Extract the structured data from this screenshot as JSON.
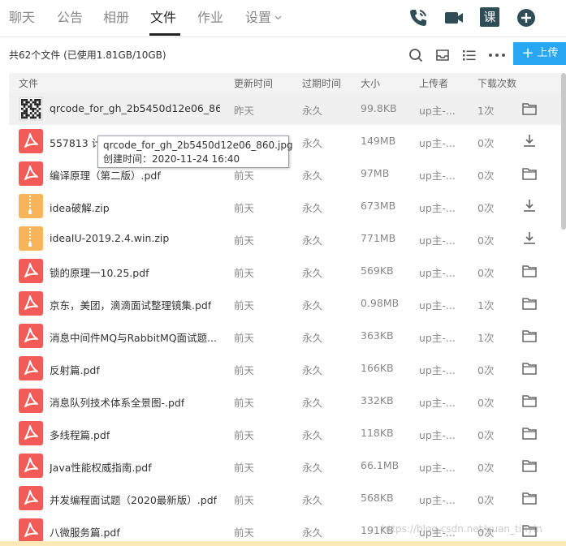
{
  "tabs": [
    {
      "label": "聊天",
      "active": false
    },
    {
      "label": "公告",
      "active": false
    },
    {
      "label": "相册",
      "active": false
    },
    {
      "label": "文件",
      "active": true
    },
    {
      "label": "作业",
      "active": false
    },
    {
      "label": "设置",
      "active": false
    }
  ],
  "top_icons": [
    "phone-icon",
    "video-icon",
    "course-icon",
    "add-icon"
  ],
  "course_icon_text": "课",
  "summary": "共62个文件 (已使用1.81GB/10GB)",
  "toolbar_icons": [
    "search-icon",
    "inbox-icon",
    "list-view-icon",
    "more-icon"
  ],
  "upload_label": "上传",
  "columns": {
    "name": "文件",
    "updated": "更新时间",
    "expires": "过期时间",
    "size": "大小",
    "uploader": "上传者",
    "downloads": "下载次数"
  },
  "files": [
    {
      "name": "qrcode_for_gh_2b5450d12e06_86...",
      "type": "qr",
      "updated": "昨天",
      "expires": "永久",
      "size": "99.8KB",
      "uploader": "up主-...",
      "downloads": "1次",
      "action": "folder"
    },
    {
      "name": "557813 计...",
      "type": "pdf",
      "updated": "",
      "expires": "永久",
      "size": "149MB",
      "uploader": "up主-...",
      "downloads": "0次",
      "action": "download"
    },
    {
      "name": "编译原理（第二版）.pdf",
      "type": "pdf",
      "updated": "前天",
      "expires": "永久",
      "size": "97MB",
      "uploader": "up主-...",
      "downloads": "0次",
      "action": "folder"
    },
    {
      "name": "idea破解.zip",
      "type": "zip",
      "updated": "前天",
      "expires": "永久",
      "size": "673MB",
      "uploader": "up主-...",
      "downloads": "0次",
      "action": "download"
    },
    {
      "name": "ideaIU-2019.2.4.win.zip",
      "type": "zip",
      "updated": "前天",
      "expires": "永久",
      "size": "771MB",
      "uploader": "up主-...",
      "downloads": "0次",
      "action": "download"
    },
    {
      "name": "锁的原理一10.25.pdf",
      "type": "pdf",
      "updated": "前天",
      "expires": "永久",
      "size": "569KB",
      "uploader": "up主-...",
      "downloads": "0次",
      "action": "folder"
    },
    {
      "name": "京东，美团，滴滴面试整理镜集.pdf",
      "type": "pdf",
      "updated": "前天",
      "expires": "永久",
      "size": "0.98MB",
      "uploader": "up主-...",
      "downloads": "1次",
      "action": "folder"
    },
    {
      "name": "消息中间件MQ与RabbitMQ面试题...",
      "type": "pdf",
      "updated": "前天",
      "expires": "永久",
      "size": "363KB",
      "uploader": "up主-...",
      "downloads": "1次",
      "action": "folder"
    },
    {
      "name": "反射篇.pdf",
      "type": "pdf",
      "updated": "前天",
      "expires": "永久",
      "size": "166KB",
      "uploader": "up主-...",
      "downloads": "0次",
      "action": "folder"
    },
    {
      "name": "消息队列技术体系全景图-.pdf",
      "type": "pdf",
      "updated": "前天",
      "expires": "永久",
      "size": "332KB",
      "uploader": "up主-...",
      "downloads": "0次",
      "action": "folder"
    },
    {
      "name": "多线程篇.pdf",
      "type": "pdf",
      "updated": "前天",
      "expires": "永久",
      "size": "118KB",
      "uploader": "up主-...",
      "downloads": "0次",
      "action": "folder"
    },
    {
      "name": "Java性能权威指南.pdf",
      "type": "pdf",
      "updated": "前天",
      "expires": "永久",
      "size": "66.1MB",
      "uploader": "up主-...",
      "downloads": "0次",
      "action": "folder"
    },
    {
      "name": "并发编程面试题（2020最新版）.pdf",
      "type": "pdf",
      "updated": "前天",
      "expires": "永久",
      "size": "568KB",
      "uploader": "up主-...",
      "downloads": "0次",
      "action": "folder"
    },
    {
      "name": "八微服务篇.pdf",
      "type": "pdf",
      "updated": "前天",
      "expires": "永久",
      "size": "191KB",
      "uploader": "up主-...",
      "downloads": "0次",
      "action": "folder"
    }
  ],
  "tooltip": {
    "line1": "qrcode_for_gh_2b5450d12e06_860.jpg",
    "line2": "创建时间：2020-11-24 16:40"
  },
  "watermark": "https://blog.csdn.net/yuan_tinyin",
  "colors": {
    "accent": "#29a7f3",
    "pdf_icon": "#f25b57",
    "zip_icon": "#f7b55b",
    "top_icon": "#2e4d57"
  }
}
